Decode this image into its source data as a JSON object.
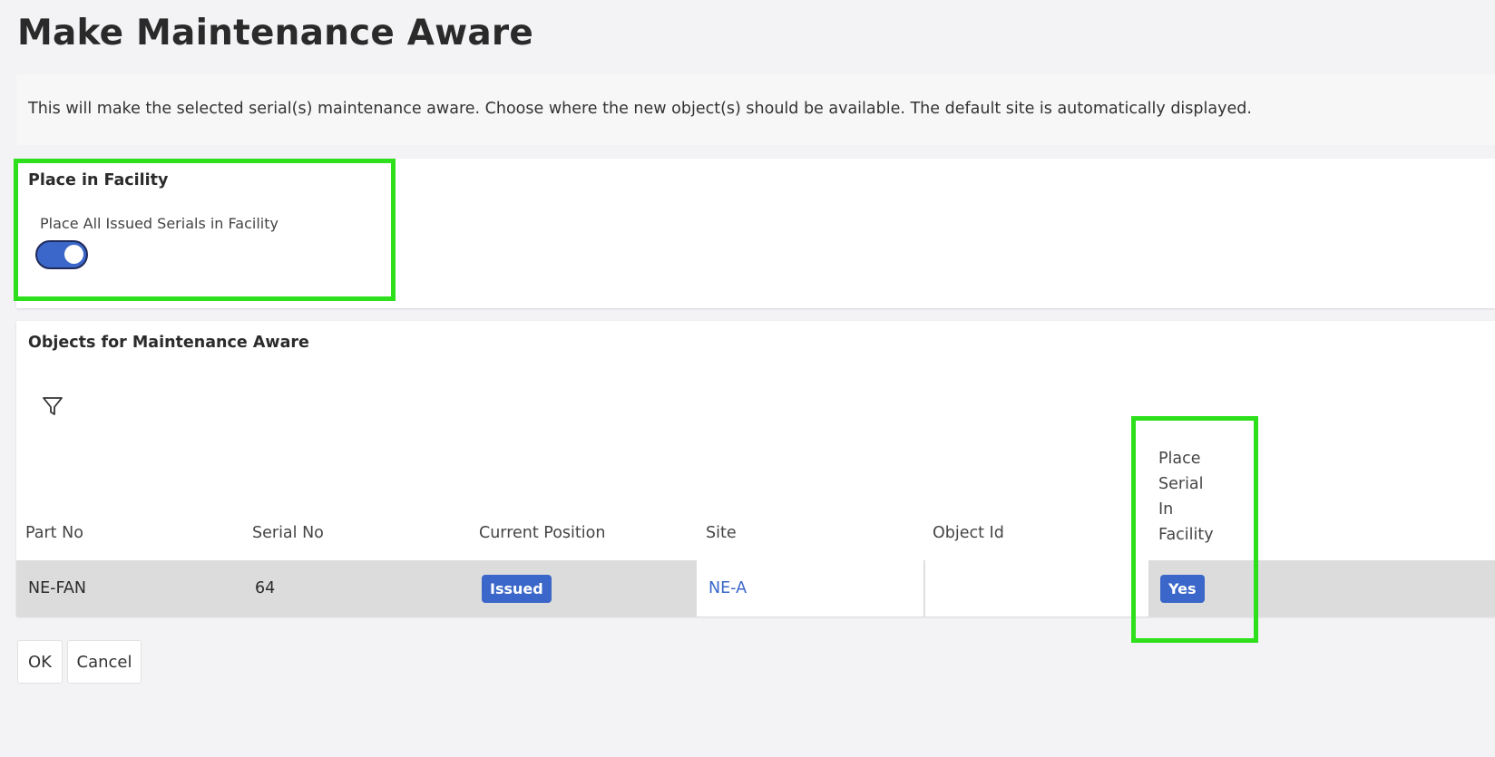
{
  "page": {
    "title": "Make Maintenance Aware",
    "info": "This will make the selected serial(s) maintenance aware. Choose where the new object(s) should be available. The default site is automatically displayed."
  },
  "facility": {
    "title": "Place in Facility",
    "toggle_label": "Place All Issued Serials in Facility",
    "toggle_on": true,
    "toggle_color": "#3a67c9"
  },
  "objects": {
    "title": "Objects for Maintenance Aware",
    "filter_icon": "filter-icon",
    "columns": {
      "part_no": "Part No",
      "serial_no": "Serial No",
      "current_position": "Current Position",
      "site": "Site",
      "object_id": "Object Id",
      "place_serial_line1": "Place",
      "place_serial_line2": "Serial",
      "place_serial_line3": "In",
      "place_serial_line4": "Facility"
    },
    "rows": [
      {
        "part_no": "NE-FAN",
        "serial_no": "64",
        "current_position": "Issued",
        "site": "NE-A",
        "object_id": "",
        "place_serial_in_facility": "Yes"
      }
    ]
  },
  "buttons": {
    "ok": "OK",
    "cancel": "Cancel"
  },
  "colors": {
    "accent": "#3a67c9",
    "highlight": "#2de01b"
  }
}
